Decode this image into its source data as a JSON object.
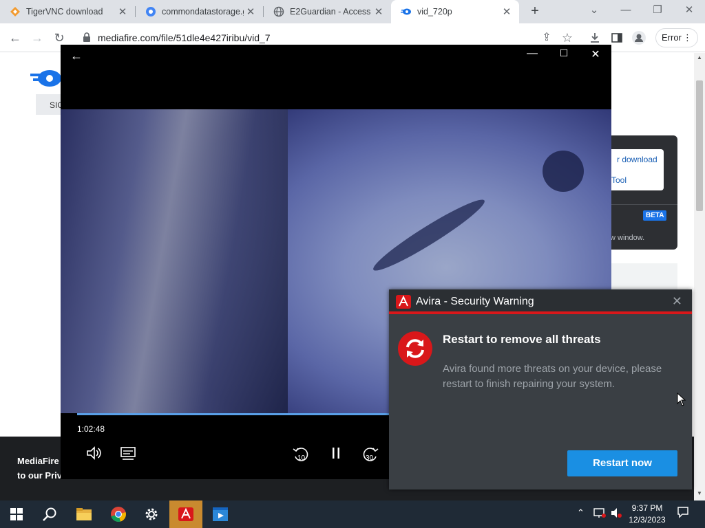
{
  "browser": {
    "tabs": [
      {
        "title": "TigerVNC download",
        "active": false
      },
      {
        "title": "commondatastorage.g",
        "active": false
      },
      {
        "title": "E2Guardian - Access D",
        "active": false
      },
      {
        "title": "vid_720p",
        "active": true
      }
    ],
    "url": "mediafire.com/file/51dle4e427iribu/vid_7",
    "error_label": "Error"
  },
  "page": {
    "signin_label": "SIG",
    "download_panel": {
      "line1": "r download",
      "line2": "Tool",
      "beta": "BETA",
      "line3": "w window."
    },
    "footer": {
      "line1": "MediaFire r",
      "line2": "to our Priva"
    }
  },
  "player": {
    "time": "1:02:48",
    "progress_fraction": 0.625,
    "skip_back": "10",
    "skip_forward": "30"
  },
  "avira": {
    "title": "Avira - Security Warning",
    "headline": "Restart to remove all threats",
    "body": "Avira found more threats on your device, please restart to finish repairing your system.",
    "button": "Restart now"
  },
  "taskbar": {
    "time": "9:37 PM",
    "date": "12/3/2023"
  },
  "colors": {
    "avira_red": "#d9171a",
    "restart_blue": "#1a8fe3",
    "progress_blue": "#5aa0e8",
    "taskbar": "#1f2a36"
  }
}
